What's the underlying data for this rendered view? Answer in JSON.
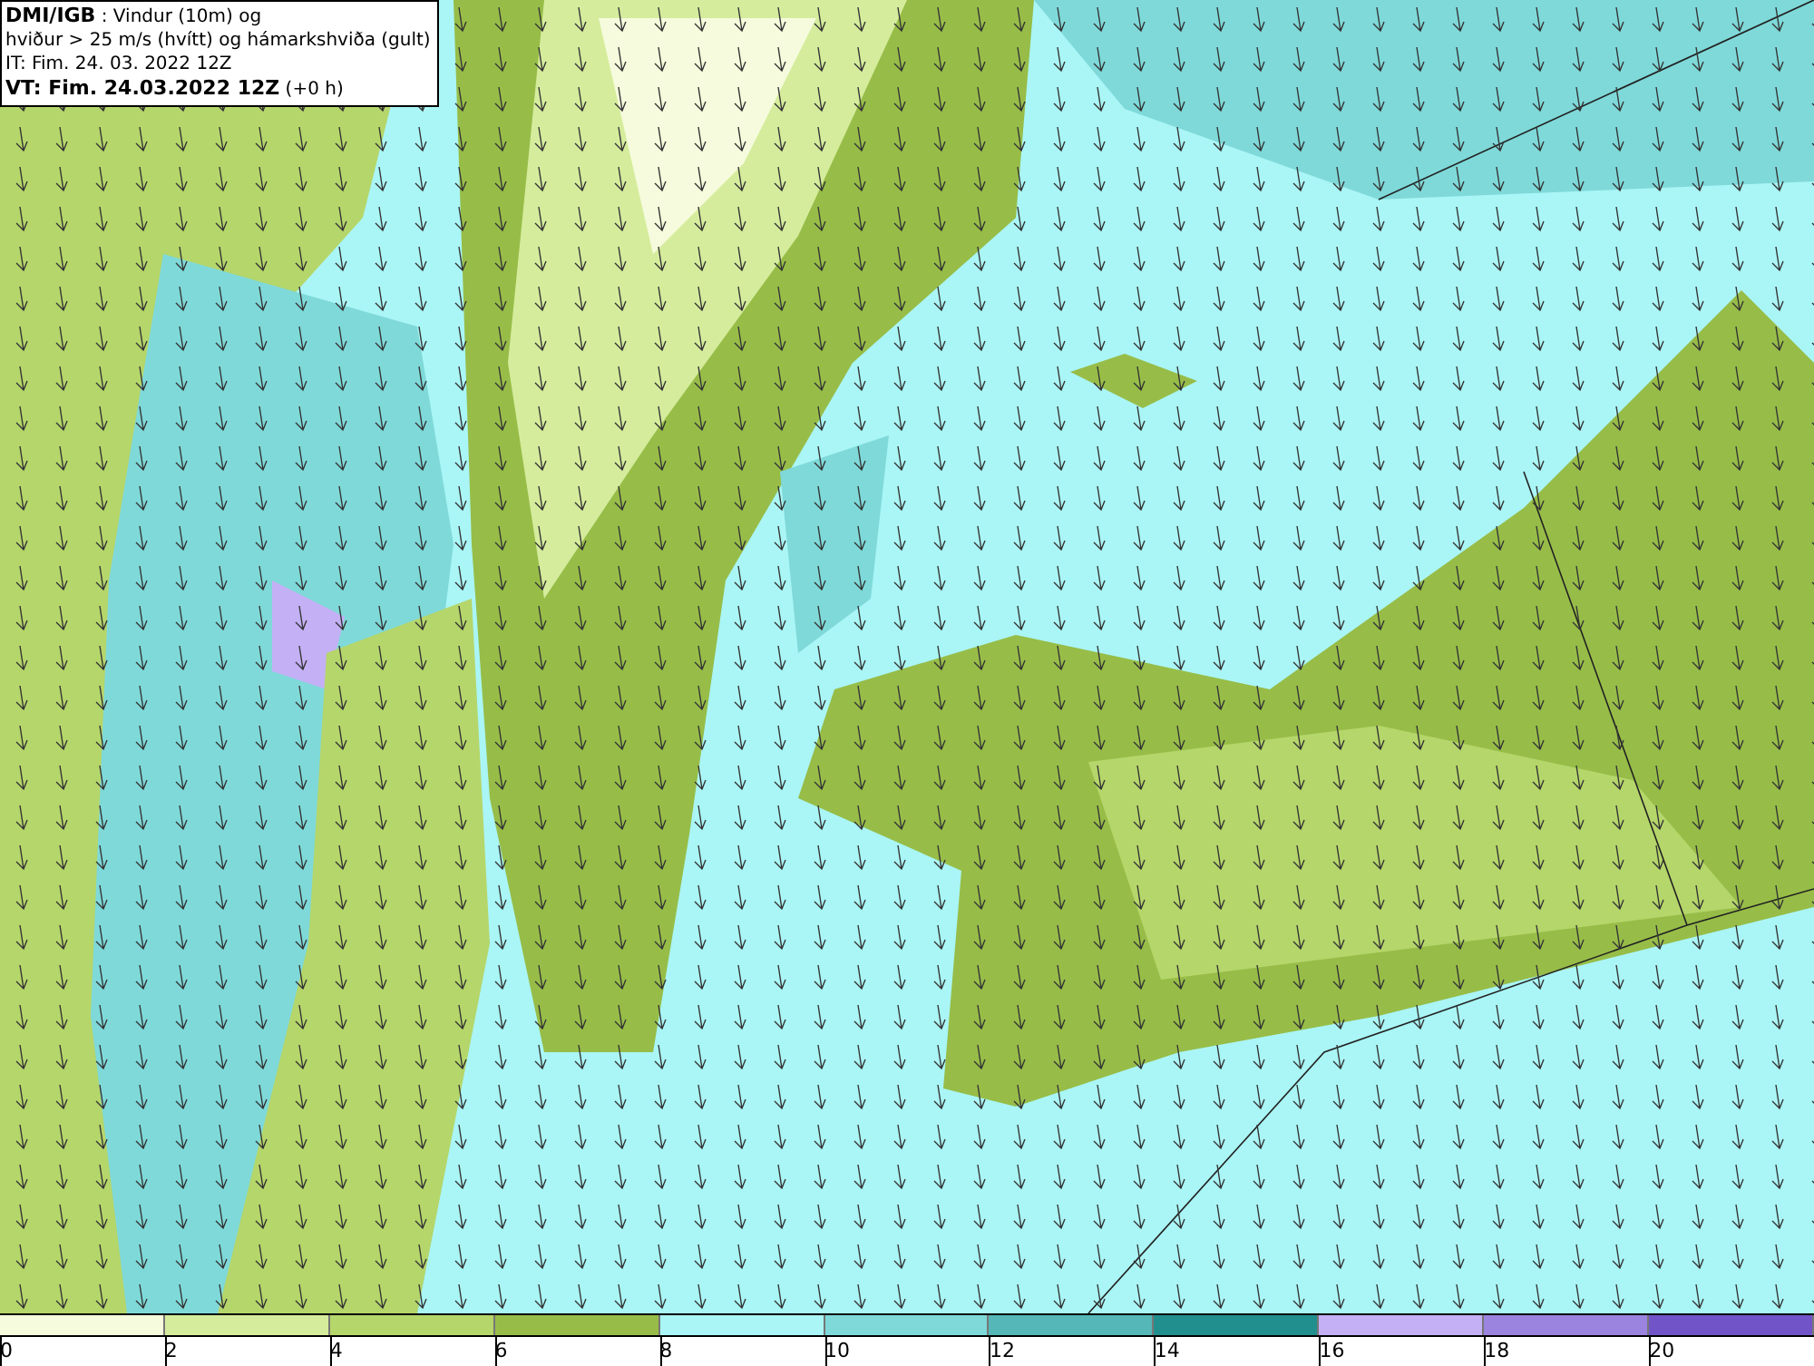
{
  "title_box": {
    "lines": [
      "**DMI/IGB** : Vindur (10m) og",
      "hviður > 25 m/s (hvítt) og hámarkshviða (gult)",
      "IT: Fim. 24. 03. 2022 12Z",
      "**VT: Fim. 24.03.2022 12Z** (+0 h)"
    ]
  },
  "legend": {
    "bins": [
      {
        "label": "0",
        "color": "#f5fbdc"
      },
      {
        "label": "2",
        "color": "#d5ec9c"
      },
      {
        "label": "4",
        "color": "#b5d66a"
      },
      {
        "label": "6",
        "color": "#97bd48"
      },
      {
        "label": "8",
        "color": "#aaf5f5"
      },
      {
        "label": "10",
        "color": "#7fd9d9"
      },
      {
        "label": "12",
        "color": "#55b7b7"
      },
      {
        "label": "14",
        "color": "#228f8f"
      },
      {
        "label": "16",
        "color": "#c4b0f5"
      },
      {
        "label": "18",
        "color": "#9b83e0"
      },
      {
        "label": "20",
        "color": "#7155c8"
      }
    ]
  }
}
